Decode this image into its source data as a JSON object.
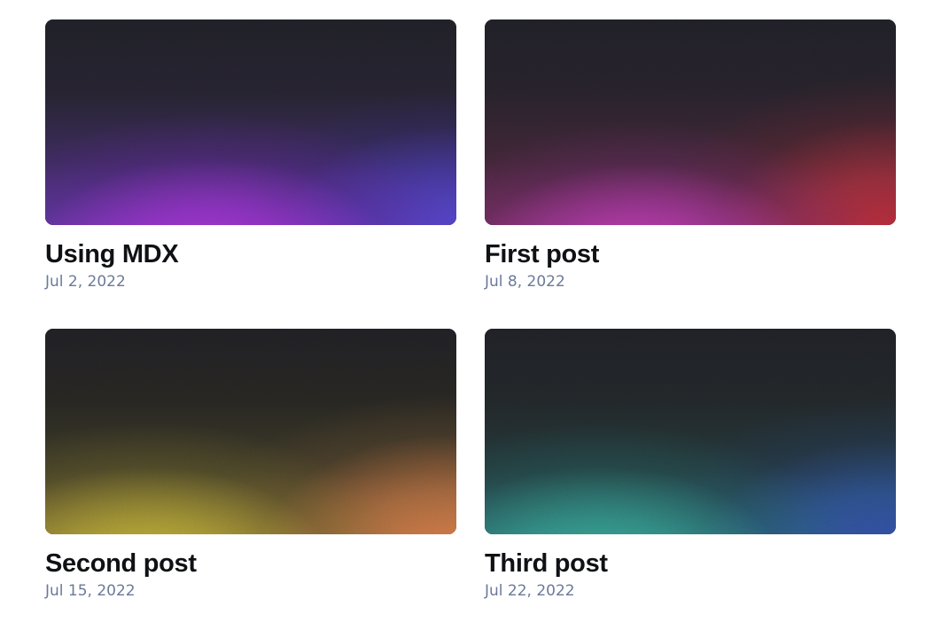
{
  "posts": [
    {
      "title": "Using MDX",
      "date": "Jul 2, 2022",
      "gradient": "purple"
    },
    {
      "title": "First post",
      "date": "Jul 8, 2022",
      "gradient": "pink"
    },
    {
      "title": "Second post",
      "date": "Jul 15, 2022",
      "gradient": "gold"
    },
    {
      "title": "Third post",
      "date": "Jul 22, 2022",
      "gradient": "teal"
    }
  ],
  "colors": {
    "title": "#0f1114",
    "date": "#6b7a99",
    "background": "#ffffff"
  }
}
